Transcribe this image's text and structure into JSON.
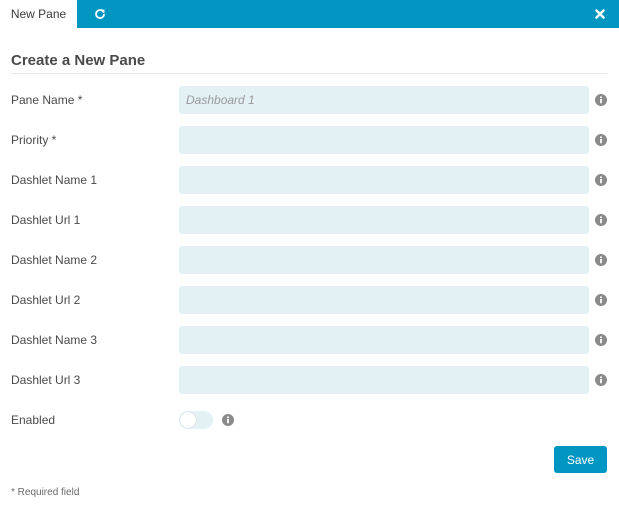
{
  "tabs": {
    "active_label": "New Pane"
  },
  "icons": {
    "refresh": "refresh-icon",
    "close": "close-icon",
    "info": "info-icon"
  },
  "form": {
    "title": "Create a New Pane",
    "fields": [
      {
        "label": "Pane Name *",
        "value": "",
        "placeholder": "Dashboard 1"
      },
      {
        "label": "Priority *",
        "value": "",
        "placeholder": ""
      },
      {
        "label": "Dashlet Name 1",
        "value": "",
        "placeholder": ""
      },
      {
        "label": "Dashlet Url 1",
        "value": "",
        "placeholder": ""
      },
      {
        "label": "Dashlet Name 2",
        "value": "",
        "placeholder": ""
      },
      {
        "label": "Dashlet Url 2",
        "value": "",
        "placeholder": ""
      },
      {
        "label": "Dashlet Name 3",
        "value": "",
        "placeholder": ""
      },
      {
        "label": "Dashlet Url 3",
        "value": "",
        "placeholder": ""
      }
    ],
    "enabled": {
      "label": "Enabled",
      "checked": false
    },
    "save_label": "Save",
    "required_note": "* Required field"
  },
  "colors": {
    "accent": "#0096c2",
    "input_bg": "#e3f1f5",
    "text": "#4a4a4a",
    "info_icon": "#8a8a8a"
  }
}
